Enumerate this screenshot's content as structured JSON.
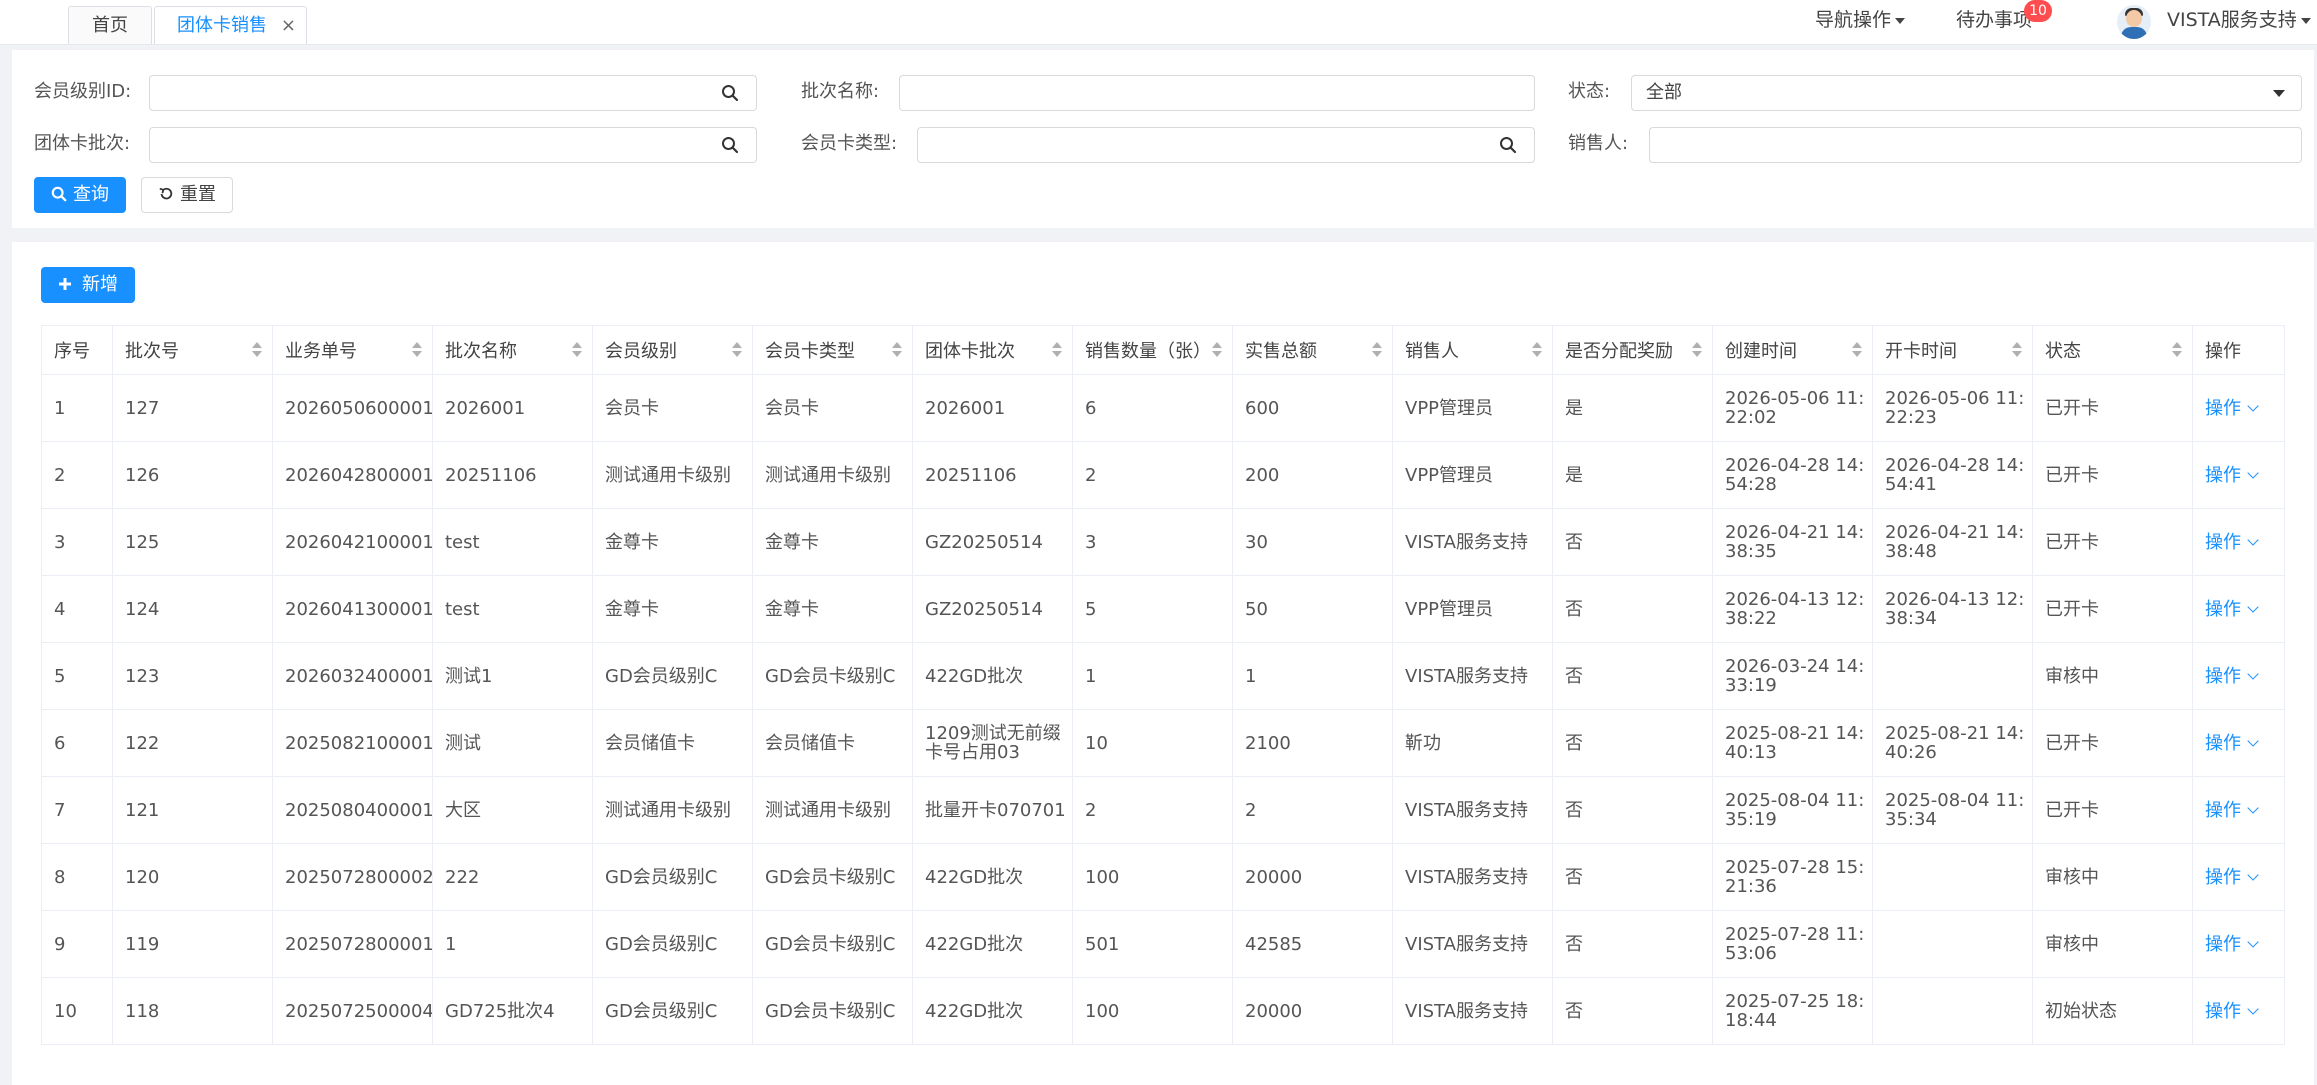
{
  "tabs": {
    "home": "首页",
    "active": "团体卡销售",
    "close": "×"
  },
  "topnav": {
    "nav_ops": "导航操作",
    "todo": "待办事项",
    "todo_count": "10",
    "user": "VISTA服务支持"
  },
  "search": {
    "member_level_id_label": "会员级别ID:",
    "batch_name_label": "批次名称:",
    "status_label": "状态:",
    "status_value": "全部",
    "group_card_batch_label": "团体卡批次:",
    "card_type_label": "会员卡类型:",
    "seller_label": "销售人:",
    "query_btn": "查询",
    "reset_btn": "重置"
  },
  "toolbar": {
    "add_btn": "新增"
  },
  "table": {
    "columns": [
      "序号",
      "批次号",
      "业务单号",
      "批次名称",
      "会员级别",
      "会员卡类型",
      "团体卡批次",
      "销售数量（张）",
      "实售总额",
      "销售人",
      "是否分配奖励",
      "创建时间",
      "开卡时间",
      "状态",
      "操作"
    ],
    "op_label": "操作",
    "rows": [
      [
        "1",
        "127",
        "2026050600001",
        "2026001",
        "会员卡",
        "会员卡",
        "2026001",
        "6",
        "600",
        "VPP管理员",
        "是",
        "2026-05-06 11:22:02",
        "2026-05-06 11:22:23",
        "已开卡"
      ],
      [
        "2",
        "126",
        "2026042800001",
        "20251106",
        "测试通用卡级别",
        "测试通用卡级别",
        "20251106",
        "2",
        "200",
        "VPP管理员",
        "是",
        "2026-04-28 14:54:28",
        "2026-04-28 14:54:41",
        "已开卡"
      ],
      [
        "3",
        "125",
        "2026042100001",
        "test",
        "金尊卡",
        "金尊卡",
        "GZ20250514",
        "3",
        "30",
        "VISTA服务支持",
        "否",
        "2026-04-21 14:38:35",
        "2026-04-21 14:38:48",
        "已开卡"
      ],
      [
        "4",
        "124",
        "2026041300001",
        "test",
        "金尊卡",
        "金尊卡",
        "GZ20250514",
        "5",
        "50",
        "VPP管理员",
        "否",
        "2026-04-13 12:38:22",
        "2026-04-13 12:38:34",
        "已开卡"
      ],
      [
        "5",
        "123",
        "2026032400001",
        "测试1",
        "GD会员级别C",
        "GD会员卡级别C",
        "422GD批次",
        "1",
        "1",
        "VISTA服务支持",
        "否",
        "2026-03-24 14:33:19",
        "",
        "审核中"
      ],
      [
        "6",
        "122",
        "2025082100001",
        "测试",
        "会员储值卡",
        "会员储值卡",
        "1209测试无前缀卡号占用03",
        "10",
        "2100",
        "靳功",
        "否",
        "2025-08-21 14:40:13",
        "2025-08-21 14:40:26",
        "已开卡"
      ],
      [
        "7",
        "121",
        "2025080400001",
        "大区",
        "测试通用卡级别",
        "测试通用卡级别",
        "批量开卡070701",
        "2",
        "2",
        "VISTA服务支持",
        "否",
        "2025-08-04 11:35:19",
        "2025-08-04 11:35:34",
        "已开卡"
      ],
      [
        "8",
        "120",
        "2025072800002",
        "222",
        "GD会员级别C",
        "GD会员卡级别C",
        "422GD批次",
        "100",
        "20000",
        "VISTA服务支持",
        "否",
        "2025-07-28 15:21:36",
        "",
        "审核中"
      ],
      [
        "9",
        "119",
        "2025072800001",
        "1",
        "GD会员级别C",
        "GD会员卡级别C",
        "422GD批次",
        "501",
        "42585",
        "VISTA服务支持",
        "否",
        "2025-07-28 11:53:06",
        "",
        "审核中"
      ],
      [
        "10",
        "118",
        "2025072500004",
        "GD725批次4",
        "GD会员级别C",
        "GD会员卡级别C",
        "422GD批次",
        "100",
        "20000",
        "VISTA服务支持",
        "否",
        "2025-07-25 18:18:44",
        "",
        "初始状态"
      ]
    ]
  }
}
